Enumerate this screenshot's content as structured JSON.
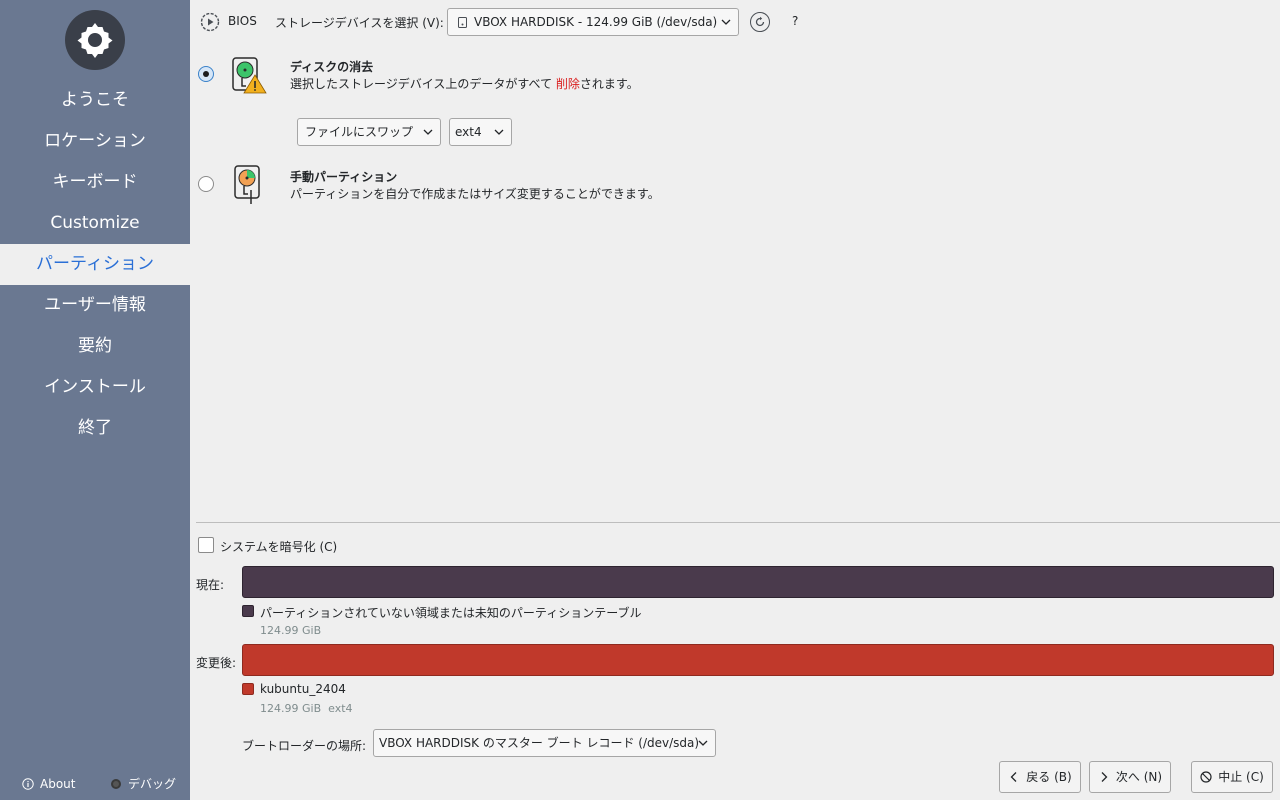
{
  "sidebar": {
    "logo_icon": "kubuntu-gear-logo",
    "items": [
      {
        "label": "ようこそ"
      },
      {
        "label": "ロケーション"
      },
      {
        "label": "キーボード"
      },
      {
        "label": "Customize"
      },
      {
        "label": "パーティション",
        "active": true
      },
      {
        "label": "ユーザー情報"
      },
      {
        "label": "要約"
      },
      {
        "label": "インストール"
      },
      {
        "label": "終了"
      }
    ],
    "about_label": "About",
    "debug_label": "デバッグ",
    "bg_color": "#6a7891",
    "active_color": "#2a6fd6"
  },
  "toolbar": {
    "boot_mode": "BIOS",
    "device_label": "ストレージデバイスを選択 (V):",
    "device_value": "VBOX HARDDISK - 124.99 GiB (/dev/sda)",
    "help_label": "?"
  },
  "options": {
    "erase": {
      "title": "ディスクの消去",
      "desc_before": "選択したストレージデバイス上のデータがすべて ",
      "desc_danger": "削除",
      "desc_after": "されます。",
      "selected": true,
      "swap_value": "ファイルにスワップ",
      "fs_value": "ext4"
    },
    "manual": {
      "title": "手動パーティション",
      "desc": "パーティションを自分で作成またはサイズ変更することができます。",
      "selected": false
    }
  },
  "encrypt": {
    "label": "システムを暗号化 (C)",
    "checked": false
  },
  "current": {
    "label": "現在:",
    "color": "#4a3a4c",
    "legend": "パーティションされていない領域または未知のパーティションテーブル",
    "size": "124.99 GiB"
  },
  "after": {
    "label": "変更後:",
    "color": "#c0392b",
    "legend": "kubuntu_2404",
    "size": "124.99 GiB",
    "fs": "ext4"
  },
  "bootloader": {
    "label": "ブートローダーの場所:",
    "value": "VBOX HARDDISK のマスター ブート レコード (/dev/sda)"
  },
  "buttons": {
    "back": "戻る (B)",
    "next": "次へ (N)",
    "cancel": "中止 (C)"
  }
}
